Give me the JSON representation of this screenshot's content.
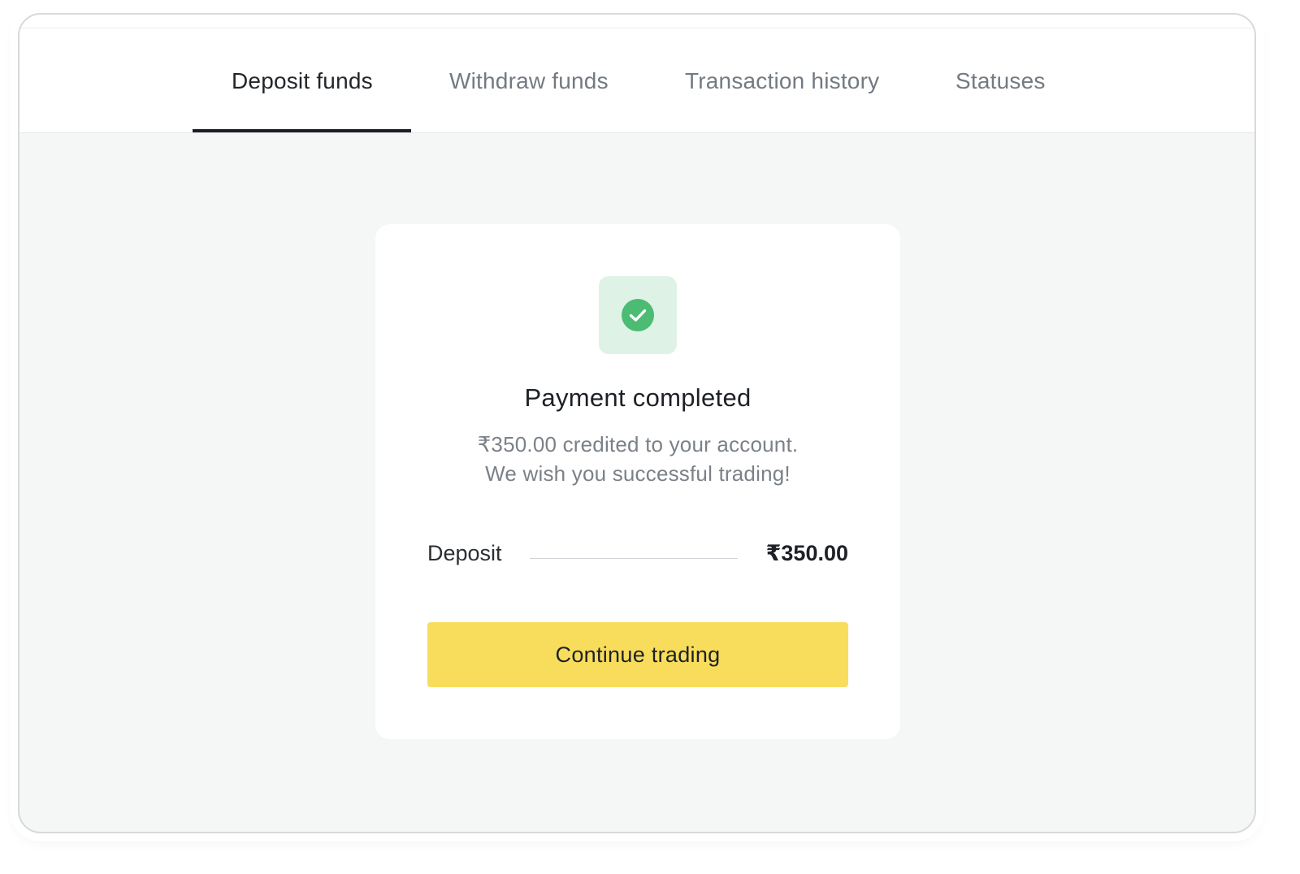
{
  "tabs": [
    {
      "label": "Deposit funds",
      "active": true
    },
    {
      "label": "Withdraw funds",
      "active": false
    },
    {
      "label": "Transaction history",
      "active": false
    },
    {
      "label": "Statuses",
      "active": false
    }
  ],
  "card": {
    "icon": "check-circle-icon",
    "title": "Payment completed",
    "message_line_1": "₹350.00 credited to your account.",
    "message_line_2": "We wish you successful trading!",
    "deposit_label": "Deposit",
    "deposit_amount": "₹350.00",
    "continue_label": "Continue trading"
  },
  "colors": {
    "accent_yellow": "#f8dd5c",
    "success_green": "#4cbb74",
    "success_bg": "#dff2e6",
    "page_bg": "#f5f6f6"
  }
}
